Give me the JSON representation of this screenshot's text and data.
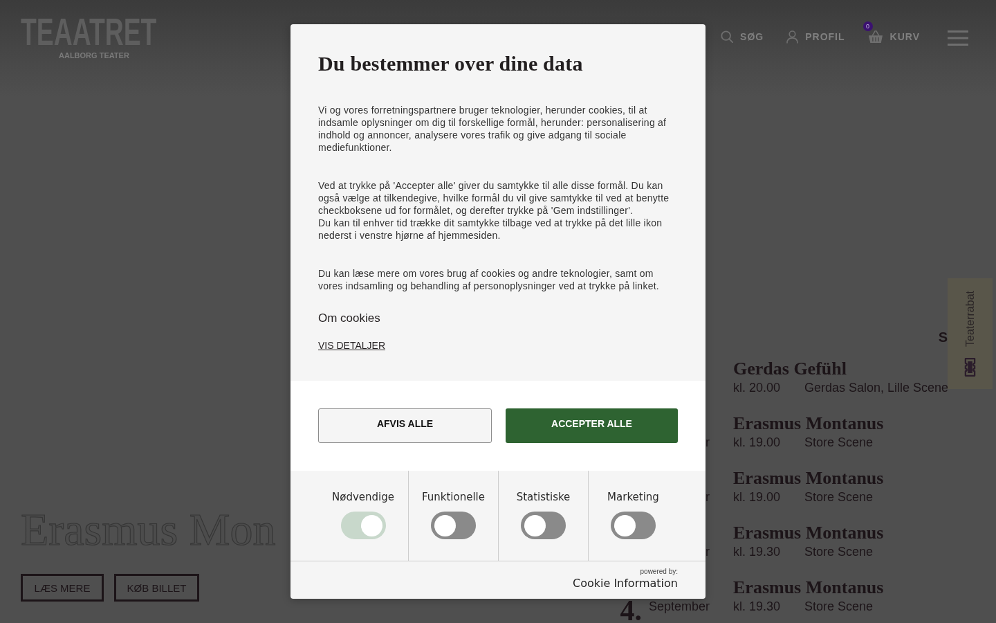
{
  "header": {
    "logo": "TEAATRET",
    "logo_subtitle": "AALBORG TEATER",
    "nav": [
      {
        "kind": "search",
        "label": "SØG"
      },
      {
        "kind": "profile",
        "label": "PROFIL"
      },
      {
        "kind": "basket",
        "label": "KURV",
        "badge": "0"
      }
    ]
  },
  "hero": {
    "title": "Erasmus Mon",
    "buttons": [
      "LÆS MERE",
      "KØB BILLET"
    ]
  },
  "program": {
    "heading": "S",
    "events": [
      {
        "title": "Gerdas Gefühl",
        "time": "kl. 20.00",
        "venue": "Gerdas Salon, Lille Scene"
      },
      {
        "month": "r",
        "title": "Erasmus Montanus",
        "time": "kl. 19.00",
        "venue": "Store Scene"
      },
      {
        "month": "r",
        "title": "Erasmus Montanus",
        "time": "kl. 19.00",
        "venue": "Store Scene"
      },
      {
        "month": "r",
        "title": "Erasmus Montanus",
        "time": "kl. 19.30",
        "venue": "Store Scene"
      },
      {
        "day": "4.",
        "month": "September",
        "title": "Erasmus Montanus",
        "time": "kl. 19.30",
        "venue": "Store Scene"
      }
    ]
  },
  "side_tab": {
    "label": "Teaterrabat"
  },
  "cookie_dialog": {
    "title": "Du bestemmer over dine data",
    "paragraphs": [
      [
        "Vi og vores forretningspartnere bruger teknologier, herunder cookies, til at indsamle oplysninger om dig til forskellige formål, herunder: personalisering af indhold og annoncer, analysere vores trafik og give adgang til sociale mediefunktioner."
      ],
      [
        "Ved at trykke på 'Accepter alle' giver du samtykke til alle disse formål. Du kan også vælge at tilkendegive, hvilke formål du vil give samtykke til ved at benytte checkboksene ud for formålet, og derefter trykke på 'Gem indstillinger'.",
        "Du kan til enhver tid trække dit samtykke tilbage ved at trykke på det lille ikon nederst i venstre hjørne af hjemmesiden."
      ],
      [
        "Du kan læse mere om vores brug af cookies og andre teknologier, samt om vores indsamling og behandling af personoplysninger ved at trykke på linket."
      ]
    ],
    "section_title": "Om cookies",
    "details_link": "VIS DETALJER",
    "buttons": [
      {
        "kind": "secondary",
        "label": "AFVIS ALLE"
      },
      {
        "kind": "primary",
        "label": "ACCEPTER ALLE"
      }
    ],
    "categories": [
      {
        "label": "Nødvendige",
        "on": true,
        "disabled": true
      },
      {
        "label": "Funktionelle",
        "on": false,
        "disabled": false
      },
      {
        "label": "Statistiske",
        "on": false,
        "disabled": false
      },
      {
        "label": "Marketing",
        "on": false,
        "disabled": false
      }
    ],
    "powered_by": "powered by:",
    "provider": "Cookie Information"
  }
}
